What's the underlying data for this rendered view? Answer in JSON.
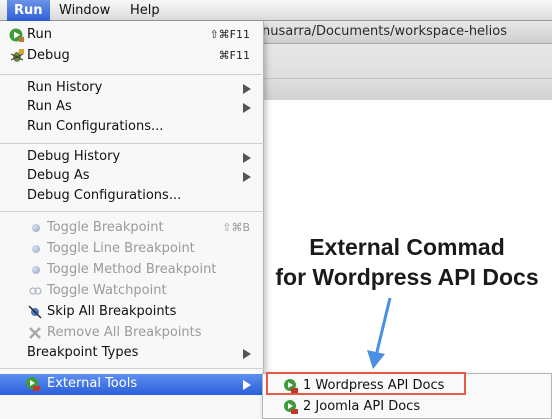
{
  "menubar": {
    "items": [
      {
        "label": "Run",
        "active": true
      },
      {
        "label": "Window",
        "active": false
      },
      {
        "label": "Help",
        "active": false
      }
    ]
  },
  "window": {
    "title_fragment": "nusarra/Documents/workspace-helios"
  },
  "run_menu": {
    "items": [
      {
        "label": "Run",
        "shortcut": "⇧⌘F11",
        "icon": "run-icon"
      },
      {
        "label": "Debug",
        "shortcut": "⌘F11",
        "icon": "debug-icon"
      },
      {
        "label": "Run History",
        "submenu": true
      },
      {
        "label": "Run As",
        "submenu": true
      },
      {
        "label": "Run Configurations..."
      },
      {
        "label": "Debug History",
        "submenu": true
      },
      {
        "label": "Debug As",
        "submenu": true
      },
      {
        "label": "Debug Configurations..."
      },
      {
        "label": "Toggle Breakpoint",
        "shortcut": "⇧⌘B",
        "disabled": true
      },
      {
        "label": "Toggle Line Breakpoint",
        "disabled": true
      },
      {
        "label": "Toggle Method Breakpoint",
        "disabled": true
      },
      {
        "label": "Toggle Watchpoint",
        "disabled": true
      },
      {
        "label": "Skip All Breakpoints"
      },
      {
        "label": "Remove All Breakpoints",
        "disabled": true
      },
      {
        "label": "Breakpoint Types",
        "submenu": true
      },
      {
        "label": "External Tools",
        "submenu": true,
        "highlighted": true
      }
    ]
  },
  "external_tools_submenu": {
    "items": [
      {
        "label": "1 Wordpress API Docs",
        "icon": "external-tool-icon"
      },
      {
        "label": "2 Joomla API Docs",
        "icon": "external-tool-icon"
      }
    ]
  },
  "annotation": {
    "line1": "External Commad",
    "line2": "for Wordpress API Docs"
  },
  "colors": {
    "highlight": "#2b5fd8",
    "callout_border": "#e65a4a",
    "arrow": "#4a90e2"
  }
}
